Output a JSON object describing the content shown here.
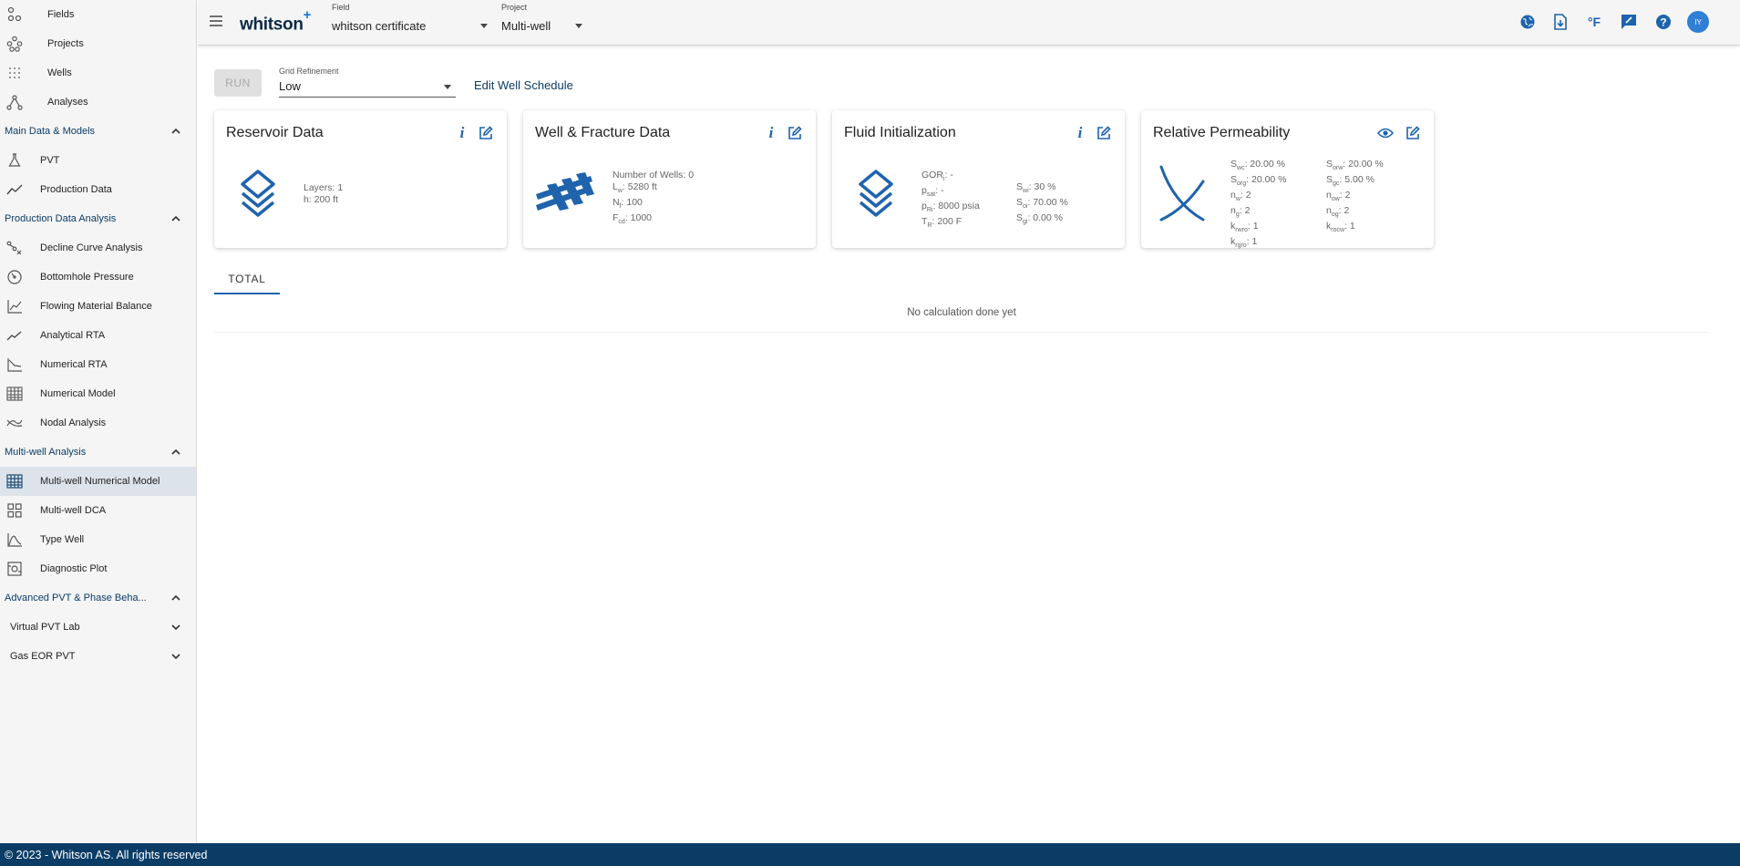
{
  "sidebar": {
    "top_items": [
      {
        "label": "Fields",
        "icon": "fields-icon"
      },
      {
        "label": "Projects",
        "icon": "projects-icon"
      },
      {
        "label": "Wells",
        "icon": "wells-icon"
      },
      {
        "label": "Analyses",
        "icon": "analyses-icon"
      }
    ],
    "sections": {
      "main_data": {
        "label": "Main Data & Models",
        "items": [
          {
            "label": "PVT",
            "icon": "flask-icon"
          },
          {
            "label": "Production Data",
            "icon": "trend-icon"
          }
        ]
      },
      "production_analysis": {
        "label": "Production Data Analysis",
        "items": [
          {
            "label": "Decline Curve Analysis",
            "icon": "decline-icon"
          },
          {
            "label": "Bottomhole Pressure",
            "icon": "gauge-icon"
          },
          {
            "label": "Flowing Material Balance",
            "icon": "chart-icon"
          },
          {
            "label": "Analytical RTA",
            "icon": "trend-icon"
          },
          {
            "label": "Numerical RTA",
            "icon": "rta-icon"
          },
          {
            "label": "Numerical Model",
            "icon": "grid-model-icon"
          },
          {
            "label": "Nodal Analysis",
            "icon": "nodal-icon"
          }
        ]
      },
      "multiwell": {
        "label": "Multi-well Analysis",
        "items": [
          {
            "label": "Multi-well Numerical Model",
            "icon": "grid-model-icon"
          },
          {
            "label": "Multi-well DCA",
            "icon": "dashboard-icon"
          },
          {
            "label": "Type Well",
            "icon": "bell-curve-icon"
          },
          {
            "label": "Diagnostic Plot",
            "icon": "diagnostic-icon"
          }
        ]
      },
      "advanced_pvt": {
        "label": "Advanced PVT & Phase Beha...",
        "items": [
          {
            "label": "Virtual PVT Lab"
          },
          {
            "label": "Gas EOR PVT"
          }
        ]
      }
    }
  },
  "header": {
    "logo": "whitson",
    "logo_plus": "+",
    "field_label": "Field",
    "field_value": "whitson certificate",
    "project_label": "Project",
    "project_value": "Multi-well",
    "temp_unit": "°F",
    "avatar_initials": "IY"
  },
  "toolbar": {
    "run_label": "RUN",
    "grid_refinement_label": "Grid Refinement",
    "grid_refinement_value": "Low",
    "edit_schedule_label": "Edit Well Schedule"
  },
  "cards": {
    "reservoir": {
      "title": "Reservoir Data",
      "layers": "Layers:  1",
      "h": "h:  200 ft"
    },
    "well_fracture": {
      "title": "Well & Fracture Data",
      "num_wells": "Number of Wells:  0",
      "lw_sym": "L",
      "lw_sub": "w",
      "lw_val": ":  5280 ft",
      "nf_sym": "N",
      "nf_sub": "f",
      "nf_val": ":  100",
      "fcd_sym": "F",
      "fcd_sub": "cd",
      "fcd_val": ":  1000"
    },
    "fluid_init": {
      "title": "Fluid Initialization",
      "gor_sym": "GOR",
      "gor_sub": "i",
      "gor_val": ":  -",
      "psat_sym": "p",
      "psat_sub": "sat",
      "psat_val": ":  -",
      "pri_sym": "p",
      "pri_sub": "Ri",
      "pri_val": ":  8000 psia",
      "tr_sym": "T",
      "tr_sub": "R",
      "tr_val": ":  200 F",
      "swi_sym": "S",
      "swi_sub": "wi",
      "swi_val": ":  30 %",
      "soi_sym": "S",
      "soi_sub": "oi",
      "soi_val": ":  70.00 %",
      "sgi_sym": "S",
      "sgi_sub": "gi",
      "sgi_val": ":  0.00 %"
    },
    "rel_perm": {
      "title": "Relative Permeability",
      "left": [
        {
          "sym": "S",
          "sub": "wc",
          "val": ":  20.00 %"
        },
        {
          "sym": "S",
          "sub": "org",
          "val": ":  20.00 %"
        },
        {
          "sym": "n",
          "sub": "w",
          "val": ":  2"
        },
        {
          "sym": "n",
          "sub": "g",
          "val": ":  2"
        },
        {
          "sym": "k",
          "sub": "rwro",
          "val": ":  1"
        },
        {
          "sym": "k",
          "sub": "rgro",
          "val": ":  1"
        }
      ],
      "right": [
        {
          "sym": "S",
          "sub": "orw",
          "val": ":  20.00 %"
        },
        {
          "sym": "S",
          "sub": "gc",
          "val": ":  5.00 %"
        },
        {
          "sym": "n",
          "sub": "ow",
          "val": ":  2"
        },
        {
          "sym": "n",
          "sub": "og",
          "val": ":  2"
        },
        {
          "sym": "k",
          "sub": "rocw",
          "val": ":  1"
        }
      ]
    }
  },
  "tabs": [
    "TOTAL"
  ],
  "empty_message": "No calculation done yet",
  "footer": "© 2023 - Whitson AS. All rights reserved",
  "colors": {
    "accent": "#1f63ad",
    "footer_bg": "#0b3c66",
    "sidebar_bg": "#f5f5f5"
  }
}
